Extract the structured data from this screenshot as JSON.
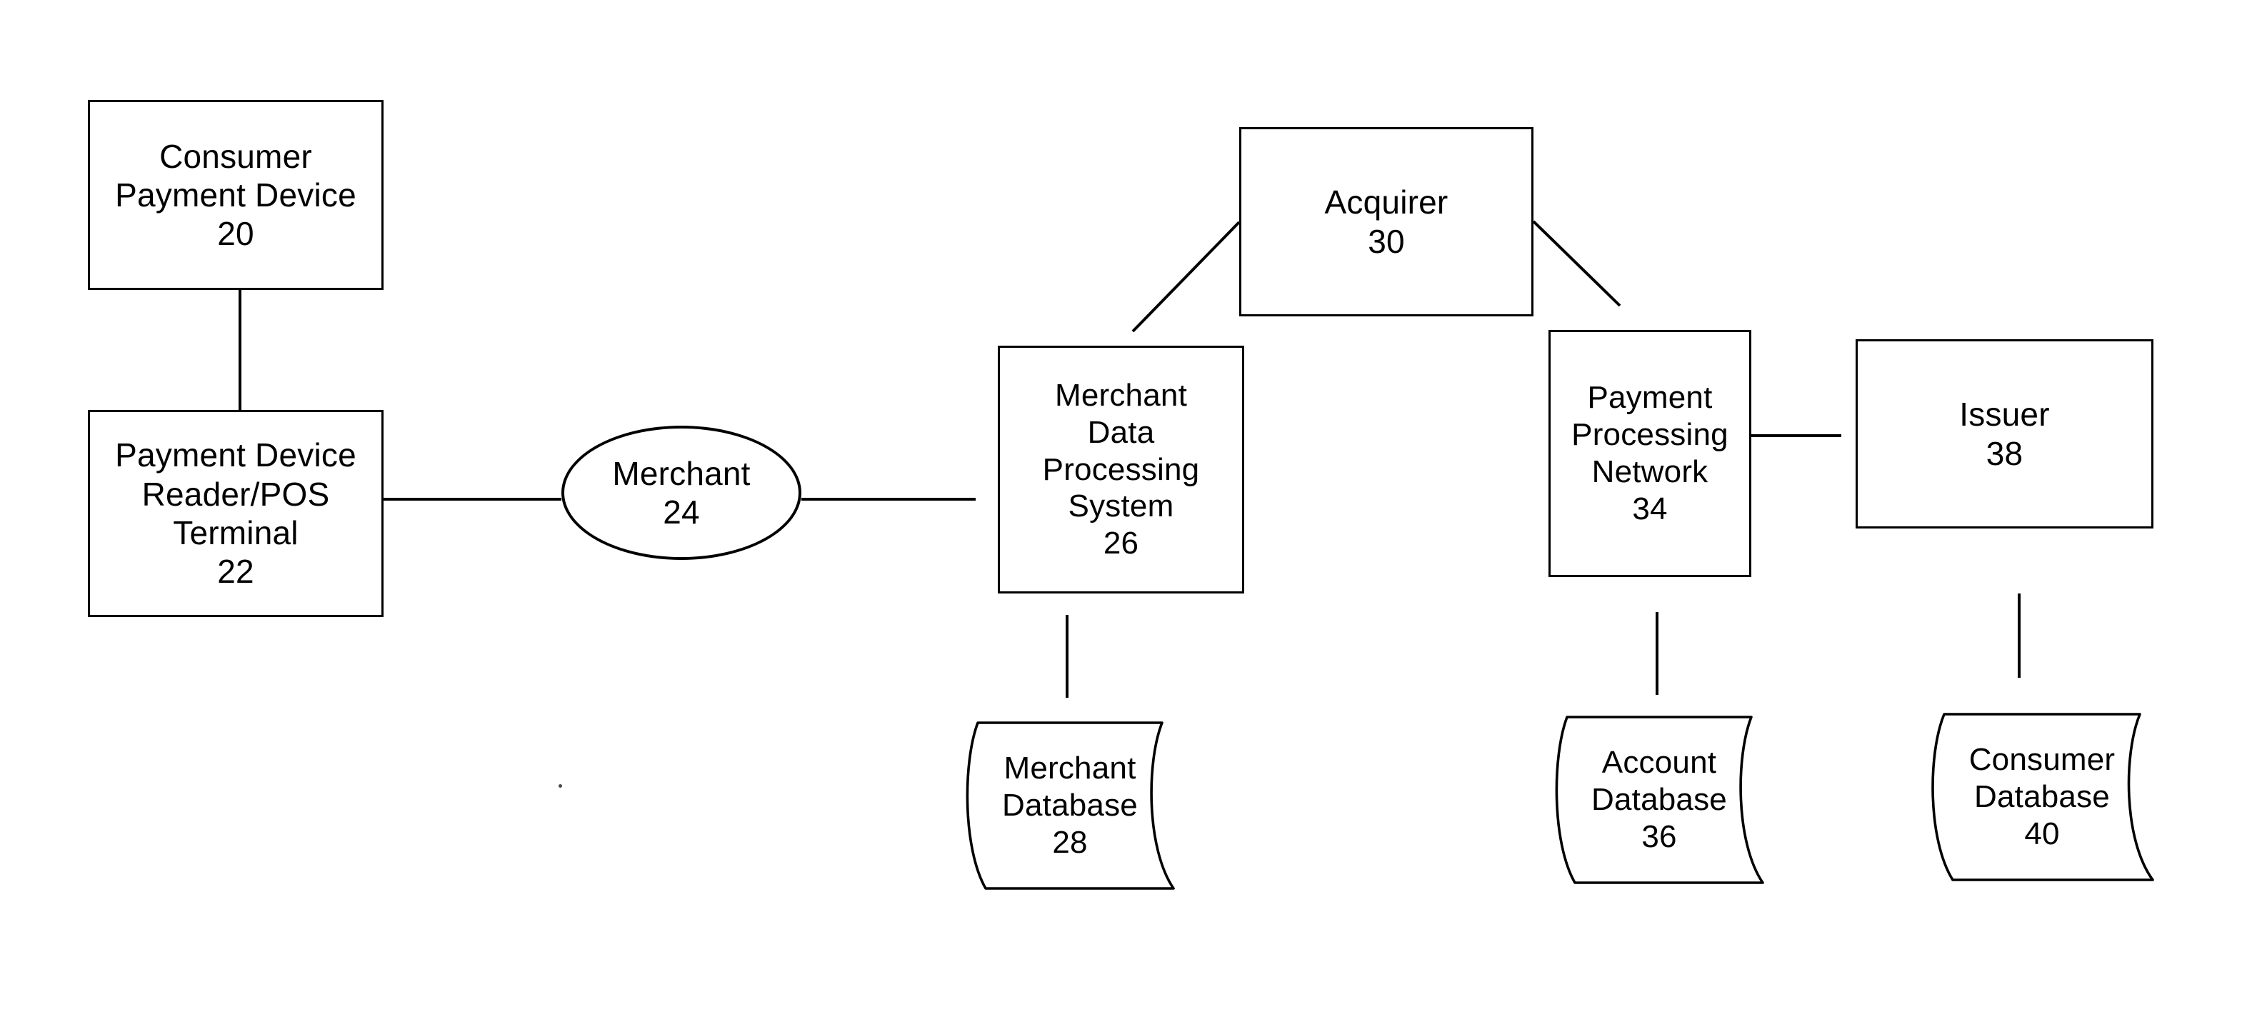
{
  "figure": {
    "type": "patent-block-diagram",
    "background_color": "#ffffff",
    "line_color": "#000000"
  },
  "nodes": {
    "consumer_payment_device": {
      "shape": "rectangle",
      "line1": "Consumer",
      "line2": "Payment Device",
      "ref": "20"
    },
    "payment_device_reader": {
      "shape": "rectangle",
      "line1": "Payment Device",
      "line2": "Reader/POS",
      "line3": "Terminal",
      "ref": "22"
    },
    "merchant": {
      "shape": "ellipse",
      "line1": "Merchant",
      "ref": "24"
    },
    "merchant_data_processing_system": {
      "shape": "rectangle",
      "line1": "Merchant",
      "line2": "Data",
      "line3": "Processing",
      "line4": "System",
      "ref": "26"
    },
    "merchant_database": {
      "shape": "tape",
      "line1": "Merchant",
      "line2": "Database",
      "ref": "28"
    },
    "acquirer": {
      "shape": "rectangle",
      "line1": "Acquirer",
      "ref": "30"
    },
    "payment_processing_network": {
      "shape": "rectangle",
      "line1": "Payment",
      "line2": "Processing",
      "line3": "Network",
      "ref": "34"
    },
    "account_database": {
      "shape": "tape",
      "line1": "Account",
      "line2": "Database",
      "ref": "36"
    },
    "issuer": {
      "shape": "rectangle",
      "line1": "Issuer",
      "ref": "38"
    },
    "consumer_database": {
      "shape": "tape",
      "line1": "Consumer",
      "line2": "Database",
      "ref": "40"
    }
  },
  "edges": [
    {
      "id": "edge-20-22",
      "from": "consumer_payment_device",
      "to": "payment_device_reader",
      "style": "vertical"
    },
    {
      "id": "edge-22-24",
      "from": "payment_device_reader",
      "to": "merchant",
      "style": "horizontal"
    },
    {
      "id": "edge-24-26",
      "from": "merchant",
      "to": "merchant_data_processing_system",
      "style": "horizontal"
    },
    {
      "id": "edge-26-30",
      "from": "merchant_data_processing_system",
      "to": "acquirer",
      "style": "diagonal"
    },
    {
      "id": "edge-30-34",
      "from": "acquirer",
      "to": "payment_processing_network",
      "style": "diagonal"
    },
    {
      "id": "edge-34-38",
      "from": "payment_processing_network",
      "to": "issuer",
      "style": "horizontal"
    },
    {
      "id": "edge-26-28",
      "from": "merchant_data_processing_system",
      "to": "merchant_database",
      "style": "vertical"
    },
    {
      "id": "edge-34-36",
      "from": "payment_processing_network",
      "to": "account_database",
      "style": "vertical"
    },
    {
      "id": "edge-38-40",
      "from": "issuer",
      "to": "consumer_database",
      "style": "vertical"
    }
  ]
}
